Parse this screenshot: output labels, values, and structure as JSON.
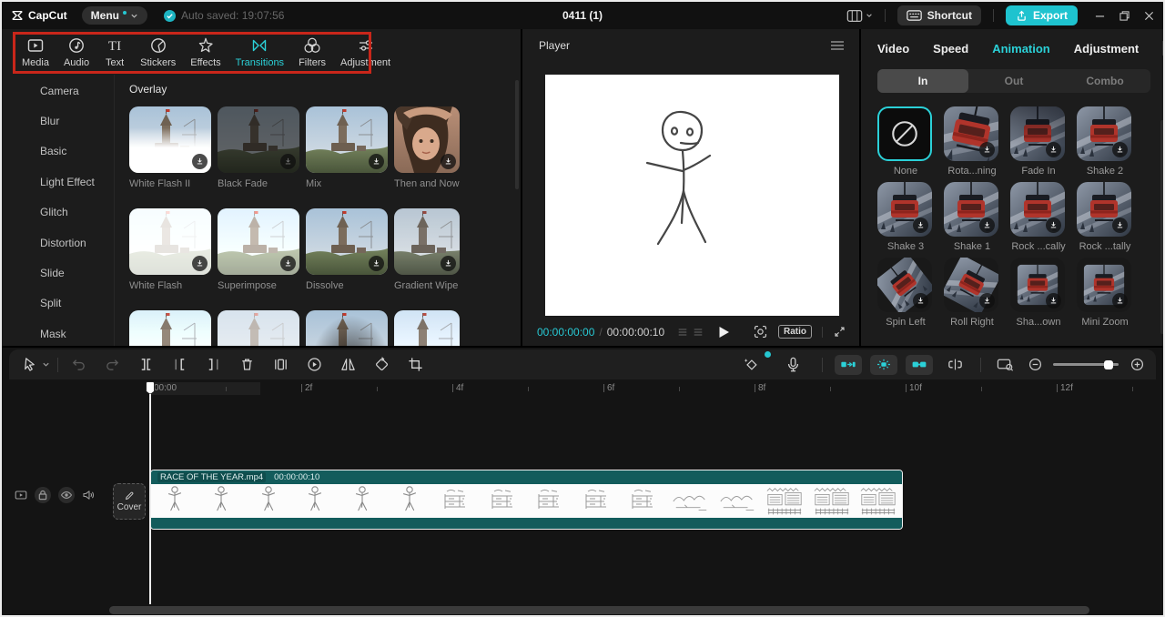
{
  "colors": {
    "accent": "#2bd1d8",
    "highlight_red": "#c9261a",
    "clip_teal": "#135c5c",
    "export_bg": "#1ec3cf"
  },
  "titlebar": {
    "app_name": "CapCut",
    "menu": "Menu",
    "autosave": "Auto saved: 19:07:56",
    "project_title": "0411 (1)",
    "shortcut": "Shortcut",
    "export": "Export"
  },
  "media_tabs": [
    {
      "label": "Media",
      "icon": "media",
      "active": false
    },
    {
      "label": "Audio",
      "icon": "audio",
      "active": false
    },
    {
      "label": "Text",
      "icon": "text",
      "active": false
    },
    {
      "label": "Stickers",
      "icon": "stickers",
      "active": false
    },
    {
      "label": "Effects",
      "icon": "effects",
      "active": false
    },
    {
      "label": "Transitions",
      "icon": "transitions",
      "active": true
    },
    {
      "label": "Filters",
      "icon": "filters",
      "active": false
    },
    {
      "label": "Adjustment",
      "icon": "adjustment",
      "active": false
    }
  ],
  "categories": [
    "Camera",
    "Blur",
    "Basic",
    "Light Effect",
    "Glitch",
    "Distortion",
    "Slide",
    "Split",
    "Mask"
  ],
  "transitions": {
    "section_title": "Overlay",
    "items": [
      {
        "label": "White Flash II",
        "variant": "white-flash-ii"
      },
      {
        "label": "Black Fade",
        "variant": "black-fade"
      },
      {
        "label": "Mix",
        "variant": "mix"
      },
      {
        "label": "Then and Now",
        "variant": "portrait"
      },
      {
        "label": "White Flash",
        "variant": "white-flash"
      },
      {
        "label": "Superimpose",
        "variant": "superimpose"
      },
      {
        "label": "Dissolve",
        "variant": "dissolve"
      },
      {
        "label": "Gradient Wipe",
        "variant": "gradient-wipe"
      }
    ],
    "partial_variants": [
      "pale",
      "bright",
      "smoke",
      "haze"
    ]
  },
  "player": {
    "title": "Player",
    "current_time": "00:00:00:00",
    "duration": "00:00:00:10",
    "ratio": "Ratio"
  },
  "inspector": {
    "tabs": [
      {
        "label": "Video",
        "active": false
      },
      {
        "label": "Speed",
        "active": false
      },
      {
        "label": "Animation",
        "active": true
      },
      {
        "label": "Adjustment",
        "active": false
      }
    ],
    "segments": [
      {
        "label": "In",
        "active": true
      },
      {
        "label": "Out",
        "active": false
      },
      {
        "label": "Combo",
        "active": false
      }
    ],
    "presets": [
      {
        "label": "None",
        "variant": "none"
      },
      {
        "label": "Rota...ning",
        "variant": "slant"
      },
      {
        "label": "Fade In",
        "variant": "fade"
      },
      {
        "label": "Shake 2",
        "variant": "normal"
      },
      {
        "label": "Shake 3",
        "variant": "normal"
      },
      {
        "label": "Shake 1",
        "variant": "normal"
      },
      {
        "label": "Rock ...cally",
        "variant": "normal"
      },
      {
        "label": "Rock ...tally",
        "variant": "normal"
      },
      {
        "label": "Spin Left",
        "variant": "spin-left"
      },
      {
        "label": "Roll Right",
        "variant": "roll-right"
      },
      {
        "label": "Sha...own",
        "variant": "inset"
      },
      {
        "label": "Mini Zoom",
        "variant": "inset"
      }
    ]
  },
  "timeline": {
    "ruler": [
      "00:00",
      "2f",
      "4f",
      "6f",
      "8f",
      "10f",
      "12f"
    ],
    "cover": "Cover",
    "clip": {
      "name": "RACE OF THE YEAR.mp4",
      "duration": "00:00:00:10"
    },
    "filmstrip": [
      "runner",
      "runner",
      "runner",
      "runner",
      "runner",
      "runner",
      "board",
      "board",
      "board",
      "board",
      "board",
      "hills",
      "hills",
      "crowd",
      "crowd",
      "crowd"
    ]
  }
}
